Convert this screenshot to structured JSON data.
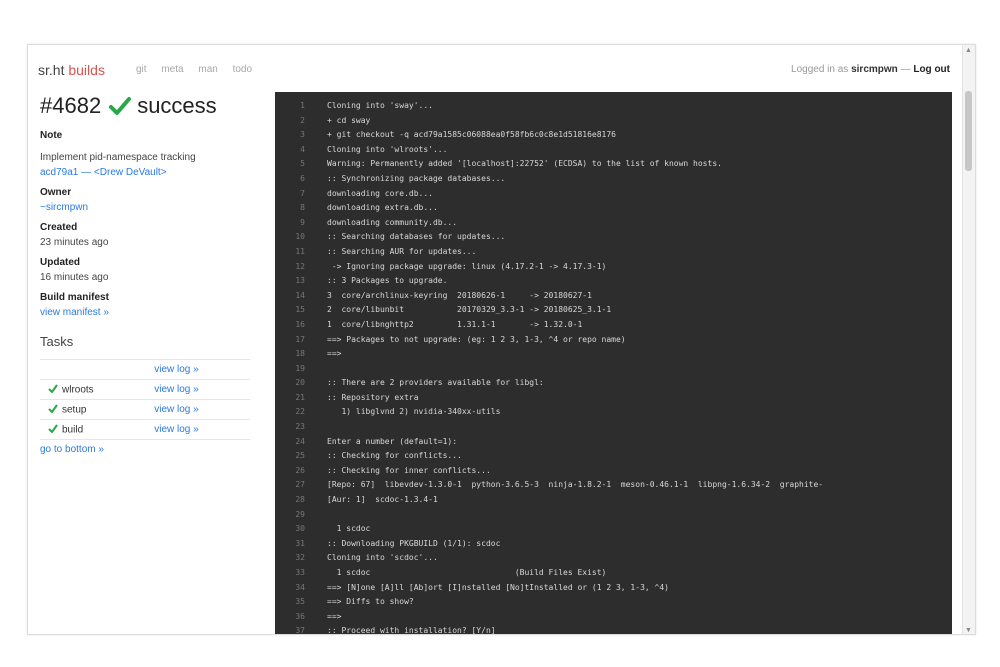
{
  "nav": {
    "brand_prefix": "sr.ht",
    "brand_accent": "builds",
    "links": [
      "git",
      "meta",
      "man",
      "todo"
    ],
    "logged_in_prefix": "Logged in as",
    "username": "sircmpwn",
    "separator": "—",
    "logout": "Log out"
  },
  "job": {
    "id": "#4682",
    "status": "success",
    "status_color": "#27a745"
  },
  "sidebar": {
    "note_label": "Note",
    "note_text": "Implement pid-namespace tracking",
    "commit_link": "acd79a1 — <Drew DeVault>",
    "owner_label": "Owner",
    "owner_value": "~sircmpwn",
    "created_label": "Created",
    "created_value": "23 minutes ago",
    "updated_label": "Updated",
    "updated_value": "16 minutes ago",
    "manifest_label": "Build manifest",
    "manifest_link": "view manifest »",
    "tasks_heading": "Tasks",
    "view_log": "view log »",
    "tasks": [
      {
        "name": "wlroots",
        "log": "view log »"
      },
      {
        "name": "setup",
        "log": "view log »"
      },
      {
        "name": "build",
        "log": "view log »"
      }
    ],
    "go_bottom": "go to bottom »"
  },
  "terminal": {
    "lines": [
      {
        "n": "1",
        "t": "Cloning into 'sway'..."
      },
      {
        "n": "2",
        "t": "+ cd sway"
      },
      {
        "n": "3",
        "t": "+ git checkout -q acd79a1585c06088ea0f58fb6c0c8e1d51816e8176"
      },
      {
        "n": "4",
        "t": "Cloning into 'wlroots'..."
      },
      {
        "n": "5",
        "t": "Warning: Permanently added '[localhost]:22752' (ECDSA) to the list of known hosts."
      },
      {
        "n": "6",
        "t": ":: Synchronizing package databases..."
      },
      {
        "n": "7",
        "t": "downloading core.db..."
      },
      {
        "n": "8",
        "t": "downloading extra.db..."
      },
      {
        "n": "9",
        "t": "downloading community.db..."
      },
      {
        "n": "10",
        "t": ":: Searching databases for updates..."
      },
      {
        "n": "11",
        "t": ":: Searching AUR for updates..."
      },
      {
        "n": "12",
        "t": " -> Ignoring package upgrade: linux (4.17.2-1 -> 4.17.3-1)"
      },
      {
        "n": "13",
        "t": ":: 3 Packages to upgrade."
      },
      {
        "n": "14",
        "t": "3  core/archlinux-keyring  20180626-1     -> 20180627-1"
      },
      {
        "n": "15",
        "t": "2  core/libunbit           20170329_3.3-1 -> 20180625_3.1-1"
      },
      {
        "n": "16",
        "t": "1  core/libnghttp2         1.31.1-1       -> 1.32.0-1"
      },
      {
        "n": "17",
        "t": "==> Packages to not upgrade: (eg: 1 2 3, 1-3, ^4 or repo name)"
      },
      {
        "n": "18",
        "t": "==>"
      },
      {
        "n": "19",
        "t": ""
      },
      {
        "n": "20",
        "t": ":: There are 2 providers available for libgl:"
      },
      {
        "n": "21",
        "t": ":: Repository extra"
      },
      {
        "n": "22",
        "t": "   1) libglvnd 2) nvidia-340xx-utils"
      },
      {
        "n": "23",
        "t": ""
      },
      {
        "n": "24",
        "t": "Enter a number (default=1):"
      },
      {
        "n": "25",
        "t": ":: Checking for conflicts..."
      },
      {
        "n": "26",
        "t": ":: Checking for inner conflicts..."
      },
      {
        "n": "27",
        "t": "[Repo: 67]  libevdev-1.3.0-1  python-3.6.5-3  ninja-1.8.2-1  meson-0.46.1-1  libpng-1.6.34-2  graphite-"
      },
      {
        "n": "28",
        "t": "[Aur: 1]  scdoc-1.3.4-1"
      },
      {
        "n": "29",
        "t": ""
      },
      {
        "n": "30",
        "t": "  1 scdoc"
      },
      {
        "n": "31",
        "t": ":: Downloading PKGBUILD (1/1): scdoc"
      },
      {
        "n": "32",
        "t": "Cloning into 'scdoc'..."
      },
      {
        "n": "33",
        "t": "  1 scdoc                              (Build Files Exist)"
      },
      {
        "n": "34",
        "t": "==> [N]one [A]ll [Ab]ort [I]nstalled [No]tInstalled or (1 2 3, 1-3, ^4)"
      },
      {
        "n": "35",
        "t": "==> Diffs to show?"
      },
      {
        "n": "36",
        "t": "==>"
      },
      {
        "n": "37",
        "t": ":: Proceed with installation? [Y/n]"
      }
    ]
  }
}
